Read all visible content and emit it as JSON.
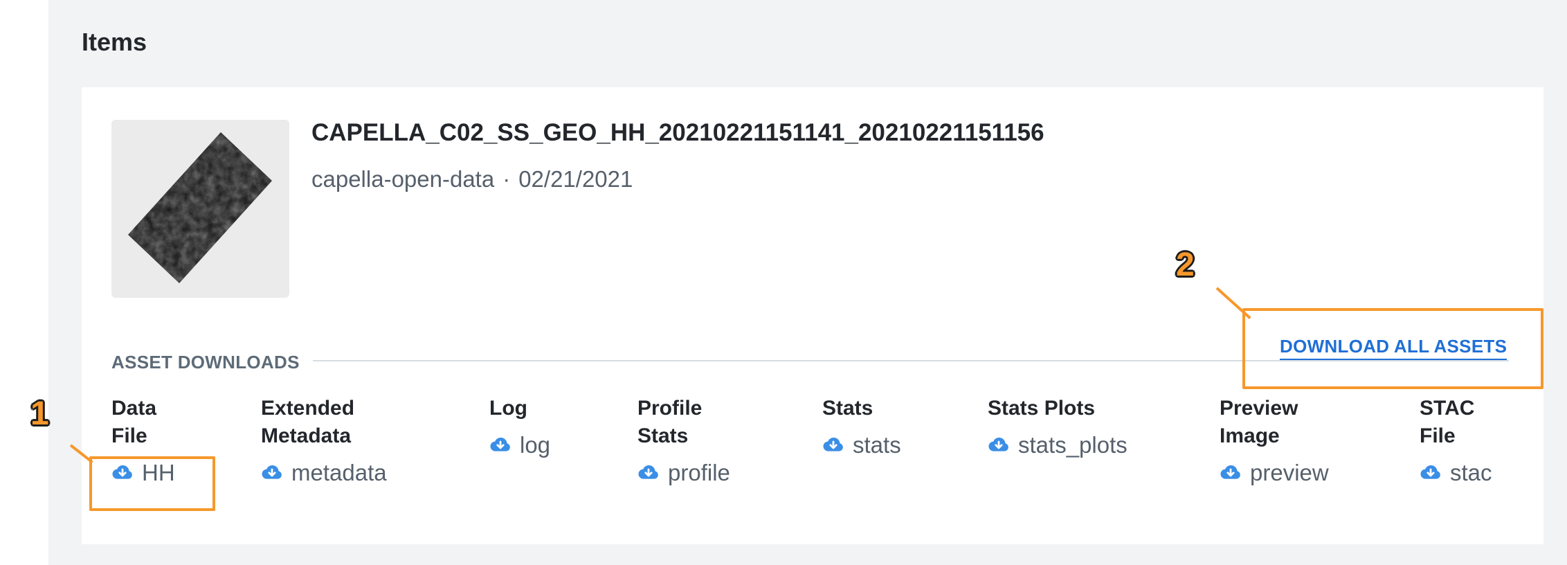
{
  "section": {
    "title": "Items"
  },
  "item": {
    "title": "CAPELLA_C02_SS_GEO_HH_20210221151141_20210221151156",
    "collection": "capella-open-data",
    "separator": "·",
    "date": "02/21/2021",
    "thumbnail_icon": "sar-image-thumbnail"
  },
  "assets": {
    "heading": "ASSET DOWNLOADS",
    "download_all_label": "DOWNLOAD ALL ASSETS",
    "items": [
      {
        "label_lines": [
          "Data",
          "File"
        ],
        "link": "HH"
      },
      {
        "label_lines": [
          "Extended",
          "Metadata"
        ],
        "link": "metadata"
      },
      {
        "label_lines": [
          "Log"
        ],
        "link": "log"
      },
      {
        "label_lines": [
          "Profile",
          "Stats"
        ],
        "link": "profile"
      },
      {
        "label_lines": [
          "Stats"
        ],
        "link": "stats"
      },
      {
        "label_lines": [
          "Stats Plots"
        ],
        "link": "stats_plots"
      },
      {
        "label_lines": [
          "Preview",
          "Image"
        ],
        "link": "preview"
      },
      {
        "label_lines": [
          "STAC",
          "File"
        ],
        "link": "stac"
      }
    ],
    "icon": "cloud-download-icon"
  },
  "annotations": [
    {
      "number": "1"
    },
    {
      "number": "2"
    }
  ],
  "colors": {
    "accent": "#1f6fd6",
    "icon": "#3a8ee6",
    "highlight": "#f6982c",
    "background": "#f2f3f5"
  }
}
